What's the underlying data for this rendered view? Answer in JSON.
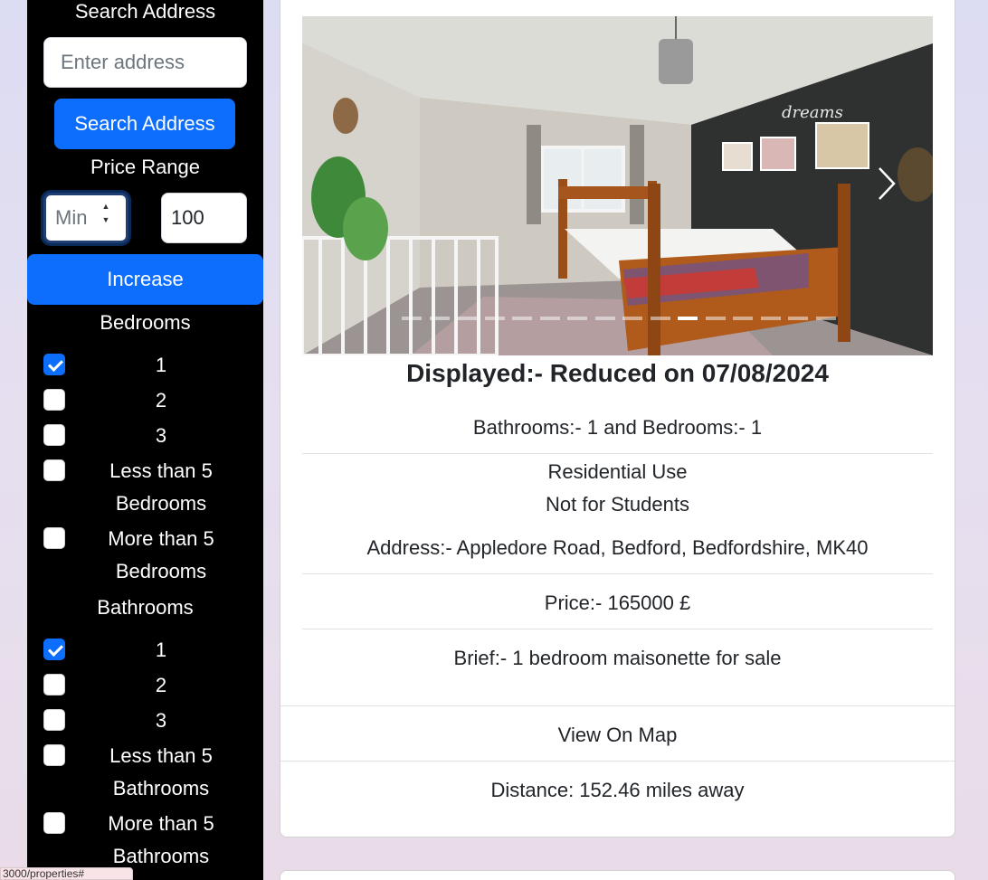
{
  "sidebar": {
    "search_heading": "Search Address",
    "address_placeholder": "Enter address",
    "search_button": "Search Address",
    "price_heading": "Price Range",
    "price_min_placeholder": "Min",
    "price_max_value": "100",
    "increase_button": "Increase",
    "bedrooms_heading": "Bedrooms",
    "bedrooms": [
      {
        "label": "1",
        "checked": true
      },
      {
        "label": "2",
        "checked": false
      },
      {
        "label": "3",
        "checked": false
      },
      {
        "label": "Less than 5 Bedrooms",
        "checked": false
      },
      {
        "label": "More than 5 Bedrooms",
        "checked": false
      }
    ],
    "bathrooms_heading": "Bathrooms",
    "bathrooms": [
      {
        "label": "1",
        "checked": true
      },
      {
        "label": "2",
        "checked": false
      },
      {
        "label": "3",
        "checked": false
      },
      {
        "label": "Less than 5 Bathrooms",
        "checked": false
      },
      {
        "label": "More than 5 Bathrooms",
        "checked": false
      }
    ]
  },
  "listing": {
    "title": "Displayed:- Reduced on 07/08/2024",
    "rooms": "Bathrooms:- 1 and Bedrooms:- 1",
    "use": "Residential Use",
    "students": "Not for Students",
    "address": "Address:- Appledore Road, Bedford, Bedfordshire, MK40",
    "price": "Price:- 165000 £",
    "brief": "Brief:- 1 bedroom maisonette for sale",
    "map_link": "View On Map",
    "distance": "Distance: 152.46 miles away",
    "photo_alt": "bedroom-photo",
    "carousel_slides": 16,
    "carousel_active": 10
  },
  "status_url": "3000/properties#"
}
